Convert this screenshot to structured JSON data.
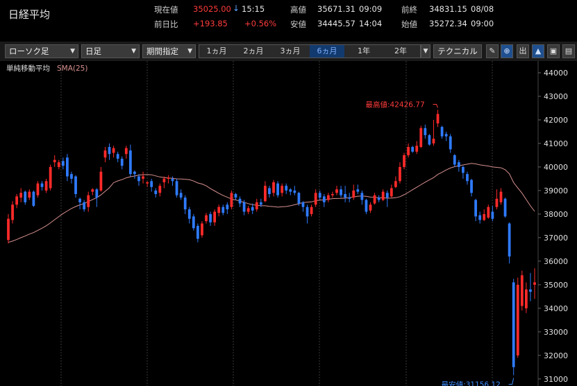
{
  "header": {
    "title": "日経平均",
    "current_label": "現在値",
    "current_value": "35025.00",
    "current_arrow": "↓",
    "current_time": "15:15",
    "change_label": "前日比",
    "change_value": "+193.85",
    "change_pct": "+0.56%",
    "high_label": "高値",
    "high_value": "35671.31",
    "high_time": "09:09",
    "low_label": "安値",
    "low_value": "34445.57",
    "low_time": "14:04",
    "prev_close_label": "前終",
    "prev_close_value": "34831.15",
    "prev_close_date": "08/08",
    "open_label": "始値",
    "open_value": "35272.34",
    "open_time": "09:00"
  },
  "toolbar": {
    "chart_type": "ローソク足",
    "interval": "日足",
    "period_select": "期間指定",
    "periods": [
      "1ヵ月",
      "2ヵ月",
      "3ヵ月",
      "6ヵ月",
      "1年",
      "2年"
    ],
    "active_period": "6ヵ月",
    "technical": "テクニカル",
    "icons": [
      "pencil-icon",
      "zoom-icon",
      "volume-icon",
      "area-chart-icon",
      "save-icon",
      "folder-icon"
    ],
    "icon_glyphs": [
      "✎",
      "⊕",
      "出",
      "▲",
      "▣",
      "▤"
    ]
  },
  "chart_data": {
    "type": "candlestick",
    "indicator_label": "単純移動平均",
    "indicator_series": "SMA(25)",
    "ylim": [
      30700,
      44500
    ],
    "yticks": [
      31000,
      32000,
      33000,
      34000,
      35000,
      36000,
      37000,
      38000,
      39000,
      40000,
      41000,
      42000,
      43000,
      44000
    ],
    "annotations": {
      "high_label": "最高値:42426.77",
      "high_value": 42426.77,
      "low_label": "最安値:31156.12",
      "low_value": 31156.12
    },
    "colors": {
      "up": "#ff2a2a",
      "down": "#2f7bff",
      "sma": "#d89090",
      "grid": "#3a3a3a",
      "high_text": "#ff3b3b",
      "low_text": "#3d8bff"
    },
    "candles": [
      [
        36900,
        37800,
        36750,
        38000
      ],
      [
        37750,
        38400,
        37600,
        38550
      ],
      [
        38400,
        38750,
        38250,
        38850
      ],
      [
        38700,
        38900,
        38500,
        39100
      ],
      [
        38950,
        38500,
        38400,
        39000
      ],
      [
        38700,
        38950,
        38600,
        39050
      ],
      [
        38950,
        38350,
        38300,
        39000
      ],
      [
        38800,
        39300,
        38700,
        39400
      ],
      [
        39300,
        39150,
        39000,
        39400
      ],
      [
        39000,
        39400,
        38900,
        39500
      ],
      [
        39100,
        40000,
        39000,
        40100
      ],
      [
        40200,
        40300,
        40000,
        40500
      ],
      [
        40000,
        40200,
        39900,
        40300
      ],
      [
        40250,
        40050,
        39900,
        40400
      ],
      [
        40400,
        39600,
        39400,
        40550
      ],
      [
        39700,
        39500,
        39300,
        39800
      ],
      [
        39600,
        38850,
        38700,
        39650
      ],
      [
        38650,
        38500,
        38200,
        38700
      ],
      [
        38500,
        38200,
        38100,
        38600
      ],
      [
        38300,
        38800,
        38100,
        38950
      ],
      [
        38950,
        39050,
        38800,
        39100
      ],
      [
        39050,
        38700,
        38300,
        39100
      ],
      [
        39000,
        39800,
        38950,
        40000
      ],
      [
        40400,
        40700,
        40200,
        40850
      ],
      [
        40850,
        40550,
        40300,
        41000
      ],
      [
        40600,
        40800,
        40400,
        40900
      ],
      [
        40550,
        40350,
        40200,
        40650
      ],
      [
        40350,
        40050,
        39900,
        40450
      ],
      [
        40550,
        40800,
        40350,
        40900
      ],
      [
        40700,
        39700,
        39600,
        40950
      ],
      [
        39800,
        39700,
        39500,
        39850
      ],
      [
        39600,
        39400,
        39200,
        39700
      ],
      [
        39500,
        39600,
        39300,
        39800
      ],
      [
        39300,
        39350,
        39150,
        39400
      ],
      [
        39400,
        39150,
        38950,
        39500
      ],
      [
        39000,
        38850,
        38700,
        39100
      ],
      [
        38900,
        39200,
        38750,
        39300
      ],
      [
        39350,
        39500,
        39100,
        39600
      ],
      [
        39500,
        39550,
        39300,
        39650
      ],
      [
        39500,
        39400,
        39200,
        39600
      ],
      [
        39400,
        38800,
        38700,
        39500
      ],
      [
        38900,
        38700,
        38600,
        39050
      ],
      [
        38700,
        38200,
        38000,
        38800
      ],
      [
        38200,
        37800,
        37600,
        38300
      ],
      [
        37900,
        37400,
        37300,
        38000
      ],
      [
        37500,
        36950,
        36800,
        37600
      ],
      [
        37100,
        37600,
        37000,
        37700
      ],
      [
        37700,
        37950,
        37600,
        38050
      ],
      [
        38000,
        37650,
        37500,
        38100
      ],
      [
        37650,
        38100,
        37500,
        38200
      ],
      [
        38050,
        38300,
        37900,
        38400
      ],
      [
        38300,
        38050,
        37950,
        38400
      ],
      [
        38400,
        38200,
        38000,
        38500
      ],
      [
        38300,
        38900,
        38200,
        39000
      ],
      [
        38850,
        38700,
        38600,
        38900
      ],
      [
        38650,
        38450,
        38300,
        38750
      ],
      [
        38500,
        38100,
        37950,
        38600
      ],
      [
        38100,
        38250,
        38000,
        38350
      ],
      [
        38300,
        38150,
        38000,
        38450
      ],
      [
        38200,
        38500,
        38100,
        38650
      ],
      [
        38500,
        38400,
        38300,
        38650
      ],
      [
        38550,
        39200,
        38500,
        39400
      ],
      [
        39100,
        38850,
        38700,
        39200
      ],
      [
        38900,
        39350,
        38750,
        39450
      ],
      [
        39300,
        38800,
        38700,
        39400
      ],
      [
        38900,
        39200,
        38750,
        39300
      ],
      [
        39200,
        39000,
        38850,
        39300
      ],
      [
        39050,
        38950,
        38800,
        39100
      ],
      [
        39000,
        38900,
        38800,
        39200
      ],
      [
        38900,
        38450,
        38350,
        38950
      ],
      [
        38500,
        38300,
        38100,
        38550
      ],
      [
        38300,
        37900,
        37600,
        38400
      ],
      [
        38000,
        38300,
        37900,
        38400
      ],
      [
        38400,
        38900,
        38300,
        39050
      ],
      [
        38900,
        38700,
        38600,
        39000
      ],
      [
        38750,
        38500,
        38300,
        38850
      ],
      [
        38600,
        38800,
        38500,
        38900
      ],
      [
        38800,
        38850,
        38700,
        38950
      ],
      [
        38900,
        39050,
        38800,
        39200
      ],
      [
        39050,
        38800,
        38700,
        39200
      ],
      [
        38850,
        38700,
        38500,
        39200
      ],
      [
        38700,
        38650,
        38500,
        38900
      ],
      [
        38700,
        39000,
        38600,
        39250
      ],
      [
        39050,
        38950,
        38850,
        39250
      ],
      [
        38900,
        38600,
        38400,
        39000
      ],
      [
        38600,
        38100,
        38000,
        38650
      ],
      [
        38150,
        38400,
        38050,
        38500
      ],
      [
        38450,
        38800,
        38400,
        38900
      ],
      [
        38700,
        38600,
        38500,
        38800
      ],
      [
        38600,
        38950,
        38550,
        39050
      ],
      [
        38900,
        38700,
        38300,
        39000
      ],
      [
        38750,
        39100,
        38700,
        39250
      ],
      [
        39150,
        39400,
        39100,
        39600
      ],
      [
        39400,
        40000,
        39300,
        40200
      ],
      [
        40000,
        40500,
        39900,
        40600
      ],
      [
        40500,
        40850,
        40400,
        41000
      ],
      [
        40850,
        40650,
        40600,
        40900
      ],
      [
        40650,
        40900,
        40550,
        41100
      ],
      [
        40850,
        41650,
        40800,
        41750
      ],
      [
        41650,
        41350,
        41200,
        41800
      ],
      [
        41350,
        40950,
        40900,
        41400
      ],
      [
        41000,
        41200,
        40900,
        42000
      ],
      [
        41850,
        42250,
        41700,
        42426.77
      ],
      [
        41700,
        41300,
        41200,
        41750
      ],
      [
        41400,
        41300,
        41100,
        41500
      ],
      [
        41300,
        40750,
        40600,
        41400
      ],
      [
        40500,
        40100,
        40000,
        40550
      ],
      [
        40200,
        40000,
        39800,
        40300
      ],
      [
        40000,
        39750,
        39500,
        40050
      ],
      [
        39700,
        39400,
        39250,
        39800
      ],
      [
        39450,
        38900,
        38750,
        39500
      ],
      [
        38600,
        37900,
        37700,
        38650
      ],
      [
        37950,
        37750,
        37600,
        38100
      ],
      [
        37750,
        38000,
        37700,
        38200
      ],
      [
        37850,
        38300,
        37800,
        38400
      ],
      [
        38100,
        37800,
        37700,
        38350
      ],
      [
        38300,
        38650,
        38200,
        39050
      ],
      [
        38500,
        38950,
        38400,
        39100
      ],
      [
        38650,
        37900,
        37850,
        38700
      ],
      [
        37600,
        36200,
        35900,
        37650
      ],
      [
        35100,
        31500,
        31156.12,
        35250
      ],
      [
        32000,
        35000,
        31900,
        35300
      ],
      [
        34100,
        35400,
        33900,
        35600
      ],
      [
        34000,
        34800,
        33800,
        35100
      ],
      [
        34800,
        34700,
        34300,
        35500
      ],
      [
        35000,
        35100,
        34400,
        35700
      ]
    ]
  }
}
